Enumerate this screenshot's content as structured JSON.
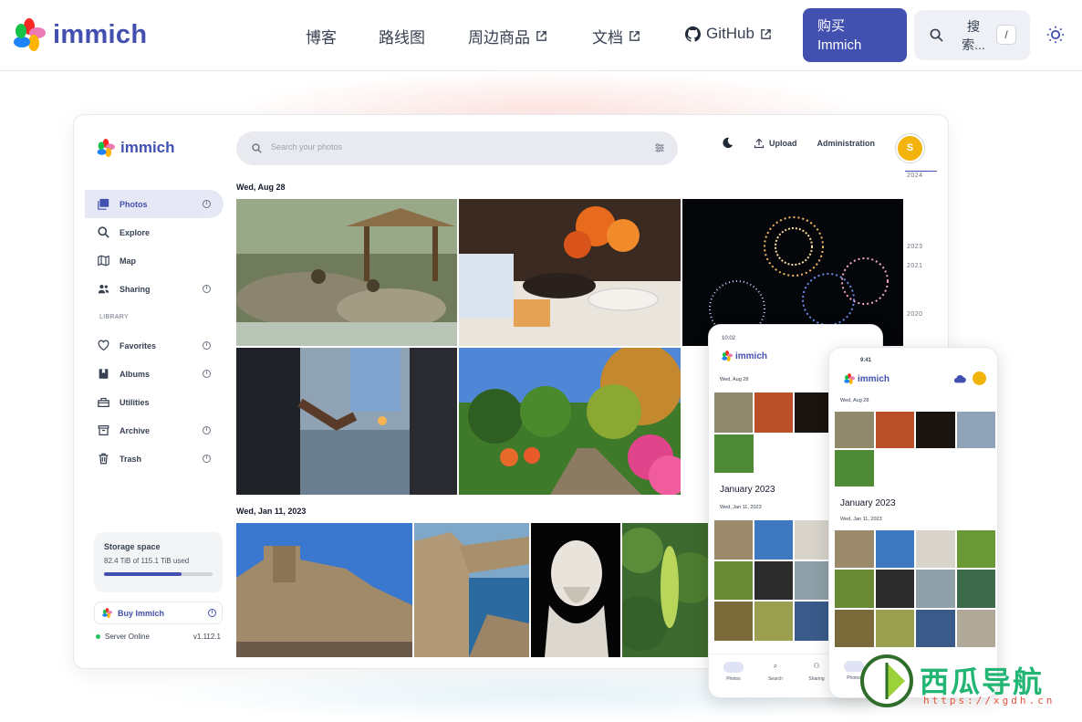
{
  "site": {
    "brand": "immich",
    "nav": [
      {
        "label": "博客",
        "external": false
      },
      {
        "label": "路线图",
        "external": false
      },
      {
        "label": "周边商品",
        "external": true
      },
      {
        "label": "文档",
        "external": true
      },
      {
        "label": "GitHub",
        "external": true
      }
    ],
    "buy_button": "购买 Immich",
    "search_label": "搜索...",
    "search_shortcut": "/"
  },
  "app": {
    "brand": "immich",
    "search_placeholder": "Search your photos",
    "upload_label": "Upload",
    "admin_label": "Administration",
    "avatar_initial": "S",
    "sidebar": {
      "items": [
        {
          "label": "Photos",
          "icon": "photos-icon",
          "active": true
        },
        {
          "label": "Explore",
          "icon": "search-icon"
        },
        {
          "label": "Map",
          "icon": "map-icon"
        },
        {
          "label": "Sharing",
          "icon": "people-icon"
        }
      ],
      "library_heading": "LIBRARY",
      "library_items": [
        {
          "label": "Favorites",
          "icon": "heart-icon"
        },
        {
          "label": "Albums",
          "icon": "album-icon"
        },
        {
          "label": "Utilities",
          "icon": "toolbox-icon"
        },
        {
          "label": "Archive",
          "icon": "archive-icon"
        },
        {
          "label": "Trash",
          "icon": "trash-icon"
        }
      ]
    },
    "storage": {
      "title": "Storage space",
      "usage": "82.4 TiB of 115.1 TiB used",
      "fraction": 0.716
    },
    "buy_label": "Buy Immich",
    "server_status": "Server Online",
    "version": "v1.112.1",
    "groups": [
      {
        "date": "Wed, Aug 28"
      },
      {
        "date": "Wed, Jan 11, 2023"
      }
    ],
    "timeline_years": [
      "2024",
      "2023",
      "2021",
      "2020"
    ]
  },
  "phone1": {
    "time": "10:02",
    "brand": "immich",
    "date1": "Wed, Aug 28",
    "month": "January 2023",
    "date2": "Wed, Jan 11, 2023",
    "nav": [
      "Photos",
      "Search",
      "Sharing"
    ]
  },
  "phone2": {
    "time": "9:41",
    "brand": "immich",
    "date1": "Wed, Aug 28",
    "month": "January 2023",
    "date2": "Wed, Jan 11, 2023",
    "nav": [
      "Photos"
    ]
  },
  "watermark": {
    "title": "西瓜导航",
    "url": "https://xgdh.cn"
  },
  "colors": {
    "brand": "#4250af",
    "avatar": "#f2b30c"
  }
}
